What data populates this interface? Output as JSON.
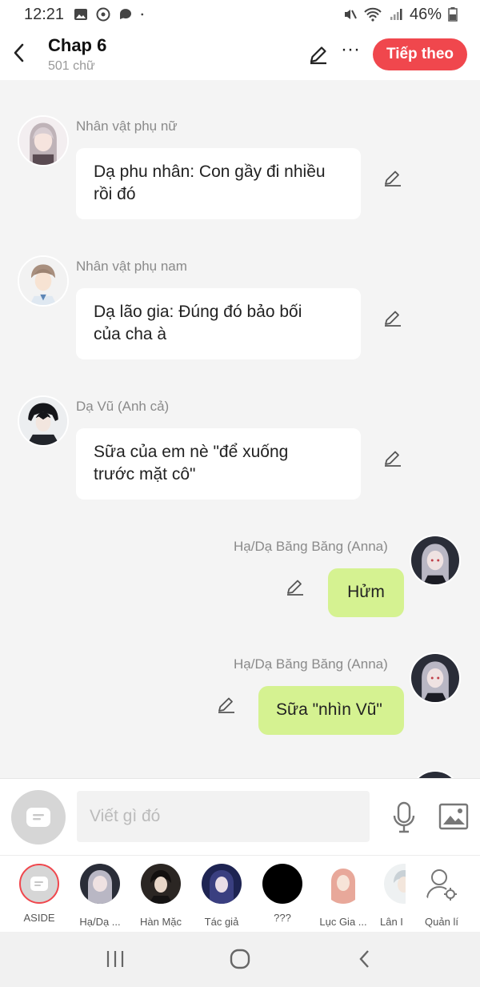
{
  "status_bar": {
    "time": "12:21",
    "battery": "46%"
  },
  "header": {
    "title": "Chap 6",
    "subtitle": "501 chữ",
    "next_label": "Tiếp theo",
    "more_label": "···"
  },
  "messages": [
    {
      "name": "Nhân vật phụ nữ",
      "text_line1": "Dạ phu nhân: Con gầy đi nhiều",
      "text_line2": "rồi đó"
    },
    {
      "name": "Nhân vật phụ nam",
      "text_line1": "Dạ lão gia: Đúng đó bảo bối",
      "text_line2": "của cha à"
    },
    {
      "name": "Dạ Vũ (Anh cả)",
      "text_line1": "Sữa của em nè \"để xuống",
      "text_line2": "trước mặt cô\""
    },
    {
      "name": "Hạ/Dạ Băng Băng (Anna)",
      "text": "Hửm"
    },
    {
      "name": "Hạ/Dạ Băng Băng (Anna)",
      "text": "Sữa \"nhìn Vũ\""
    }
  ],
  "composer": {
    "placeholder": "Viết gì đó"
  },
  "characters": [
    {
      "label": "ASIDE"
    },
    {
      "label": "Hạ/Dạ ..."
    },
    {
      "label": "Hàn Mặc"
    },
    {
      "label": "Tác giả"
    },
    {
      "label": "???"
    },
    {
      "label": "Lục Gia ..."
    },
    {
      "label": "Lân I"
    },
    {
      "label": "Quản lí"
    }
  ],
  "colors": {
    "accent": "#f0474d",
    "my_bubble": "#d5f291",
    "background": "#f4f4f4"
  }
}
